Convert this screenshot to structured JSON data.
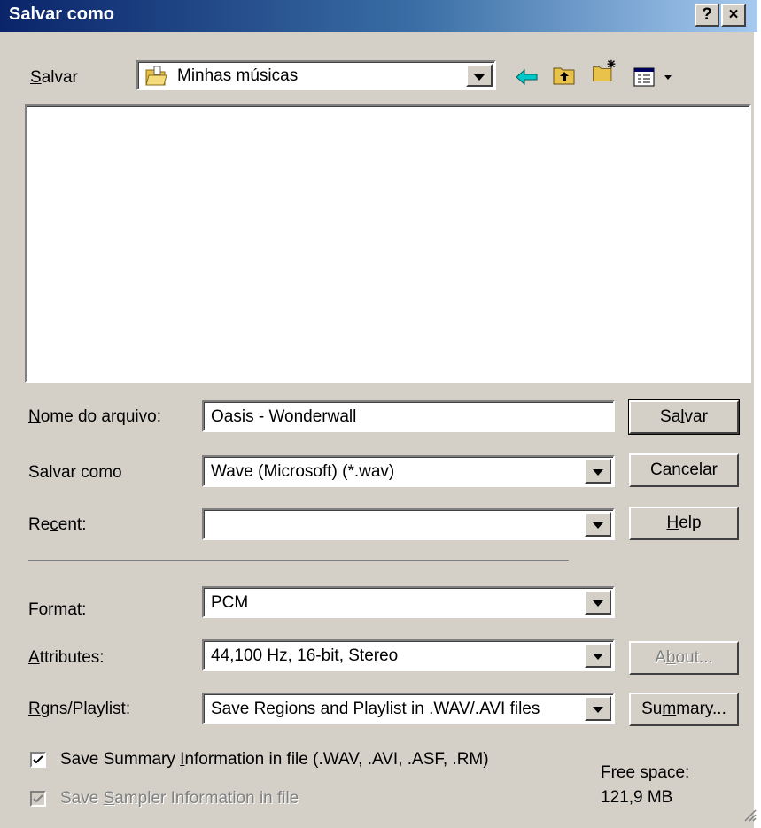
{
  "window": {
    "title": "Salvar como",
    "help_btn": "?",
    "close_btn": "×"
  },
  "save_in": {
    "label_prefix": "",
    "label_u": "S",
    "label_rest": "alvar",
    "folder": "Minhas músicas"
  },
  "filename": {
    "label_u": "N",
    "label_rest": "ome do arquivo:",
    "value": "Oasis - Wonderwall"
  },
  "save_type": {
    "label": "Salvar como",
    "value": "Wave (Microsoft) (*.wav)"
  },
  "recent": {
    "label_a": "Re",
    "label_u": "c",
    "label_b": "ent:",
    "value": ""
  },
  "format": {
    "label": "Format:",
    "value": "PCM"
  },
  "attributes": {
    "label_u": "A",
    "label_rest": "ttributes:",
    "value": "44,100 Hz, 16-bit, Stereo"
  },
  "regions": {
    "label_u": "R",
    "label_rest": "gns/Playlist:",
    "value": "Save Regions and Playlist in .WAV/.AVI files"
  },
  "buttons": {
    "save_a": "Sa",
    "save_u": "l",
    "save_b": "var",
    "cancel": "Cancelar",
    "help_u": "H",
    "help_rest": "elp",
    "about_a": "A",
    "about_u": "b",
    "about_b": "out...",
    "summary_a": "Su",
    "summary_u": "m",
    "summary_b": "mary..."
  },
  "checkboxes": {
    "summary_a": "Save Summary ",
    "summary_u": "I",
    "summary_b": "nformation in file (.WAV, .AVI, .ASF, .RM)",
    "sampler_a": "Save ",
    "sampler_u": "S",
    "sampler_b": "ampler Information in file"
  },
  "free_space": {
    "label": "Free space:",
    "value": "121,9 MB"
  },
  "icons": [
    "folder-open-icon",
    "back-arrow-icon",
    "up-folder-icon",
    "new-folder-icon",
    "view-menu-icon"
  ]
}
